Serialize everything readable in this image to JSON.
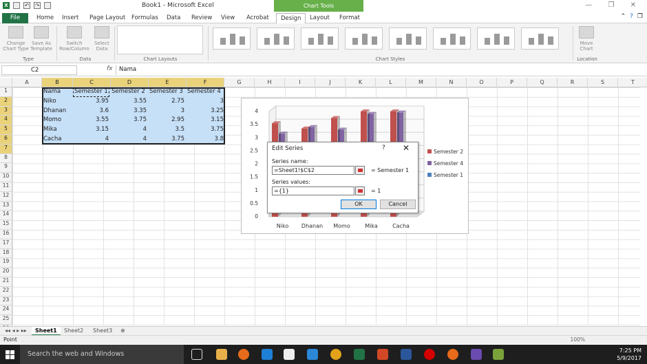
{
  "window": {
    "title": "Book1 - Microsoft Excel",
    "chart_tools": "Chart Tools"
  },
  "ribbon_tabs": [
    "File",
    "Home",
    "Insert",
    "Page Layout",
    "Formulas",
    "Data",
    "Review",
    "View",
    "Acrobat",
    "Design",
    "Layout",
    "Format"
  ],
  "active_tab": "Design",
  "ribbon": {
    "change_chart_type": "Change Chart Type",
    "save_as_template": "Save As Template",
    "switch_row_column": "Switch Row/Column",
    "select_data": "Select Data",
    "move_chart": "Move Chart",
    "groups": {
      "type": "Type",
      "data": "Data",
      "chart_layouts": "Chart Layouts",
      "chart_styles": "Chart Styles",
      "location": "Location"
    }
  },
  "formula_bar": {
    "name_box": "C2",
    "fx": "fx",
    "value": "Nama"
  },
  "columns": [
    "A",
    "B",
    "C",
    "D",
    "E",
    "F",
    "G",
    "H",
    "I",
    "J",
    "K",
    "L",
    "M",
    "N",
    "O",
    "P",
    "Q",
    "R",
    "S",
    "T"
  ],
  "rows": [
    "1",
    "2",
    "3",
    "4",
    "5",
    "6",
    "7",
    "8",
    "9",
    "10",
    "11",
    "12",
    "13",
    "14",
    "15",
    "16",
    "17",
    "18",
    "19",
    "20",
    "21",
    "22",
    "23",
    "24",
    "25",
    "26"
  ],
  "table": {
    "header": [
      "Nama",
      "Semester 1",
      "Semester 2",
      "Semester 3",
      "Semester 4"
    ],
    "rows": [
      [
        "Niko",
        "3.95",
        "3.55",
        "2.75",
        "3"
      ],
      [
        "Dhanan",
        "3.6",
        "3.35",
        "3",
        "3.25"
      ],
      [
        "Momo",
        "3.55",
        "3.75",
        "2.95",
        "3.15"
      ],
      [
        "Mika",
        "3.15",
        "4",
        "3.5",
        "3.75"
      ],
      [
        "Cacha",
        "4",
        "4",
        "3.75",
        "3.8"
      ]
    ]
  },
  "chart_data": {
    "type": "bar",
    "categories": [
      "Niko",
      "Dhanan",
      "Momo",
      "Mika",
      "Cacha"
    ],
    "series": [
      {
        "name": "Semester 2",
        "values": [
          3.55,
          3.35,
          3.75,
          4,
          4
        ],
        "color": "#c0504d"
      },
      {
        "name": "Semester 4",
        "values": [
          3,
          3.25,
          3.15,
          3.75,
          3.8
        ],
        "color": "#8064a2"
      },
      {
        "name": "Semester 1",
        "values": [
          1,
          1,
          1,
          1,
          1
        ],
        "color": "#4f81bd"
      }
    ],
    "yticks": [
      "0",
      "0.5",
      "1",
      "1.5",
      "2",
      "2.5",
      "3",
      "3.5",
      "4"
    ],
    "ylim": [
      0,
      4
    ],
    "legend": "right"
  },
  "dialog": {
    "title": "Edit Series",
    "help": "?",
    "close": "✕",
    "series_name_label": "Series name:",
    "series_name_value": "=Sheet1!$C$2",
    "series_name_result": "= Semester 1",
    "series_values_label": "Series values:",
    "series_values_value": "={1}",
    "series_values_result": "= 1",
    "ok": "OK",
    "cancel": "Cancel"
  },
  "sheets": [
    "Sheet1",
    "Sheet2",
    "Sheet3"
  ],
  "status": {
    "mode": "Point",
    "zoom": "100%"
  },
  "taskbar": {
    "search": "Search the web and Windows",
    "time": "7:25 PM",
    "date": "5/9/2017"
  }
}
